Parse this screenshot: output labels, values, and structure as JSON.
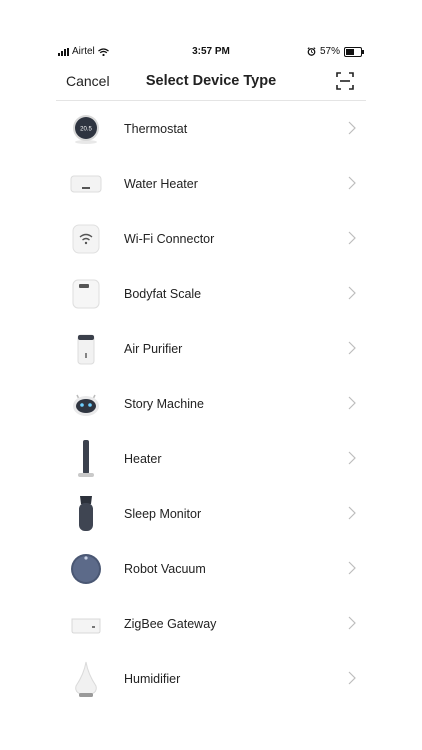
{
  "status_bar": {
    "carrier": "Airtel",
    "time": "3:57 PM",
    "battery": "57%",
    "battery_level": 0.57
  },
  "nav": {
    "cancel_label": "Cancel",
    "title": "Select Device Type",
    "scan_icon": "scan-icon"
  },
  "devices": [
    {
      "label": "Thermostat",
      "icon": "thermostat-icon"
    },
    {
      "label": "Water Heater",
      "icon": "water-heater-icon"
    },
    {
      "label": "Wi-Fi Connector",
      "icon": "wifi-connector-icon"
    },
    {
      "label": "Bodyfat Scale",
      "icon": "bodyfat-scale-icon"
    },
    {
      "label": "Air Purifier",
      "icon": "air-purifier-icon"
    },
    {
      "label": "Story Machine",
      "icon": "story-machine-icon"
    },
    {
      "label": "Heater",
      "icon": "heater-icon"
    },
    {
      "label": "Sleep Monitor",
      "icon": "sleep-monitor-icon"
    },
    {
      "label": "Robot Vacuum",
      "icon": "robot-vacuum-icon"
    },
    {
      "label": "ZigBee Gateway",
      "icon": "zigbee-gateway-icon"
    },
    {
      "label": "Humidifier",
      "icon": "humidifier-icon"
    }
  ],
  "thermostat_display": "20.5"
}
